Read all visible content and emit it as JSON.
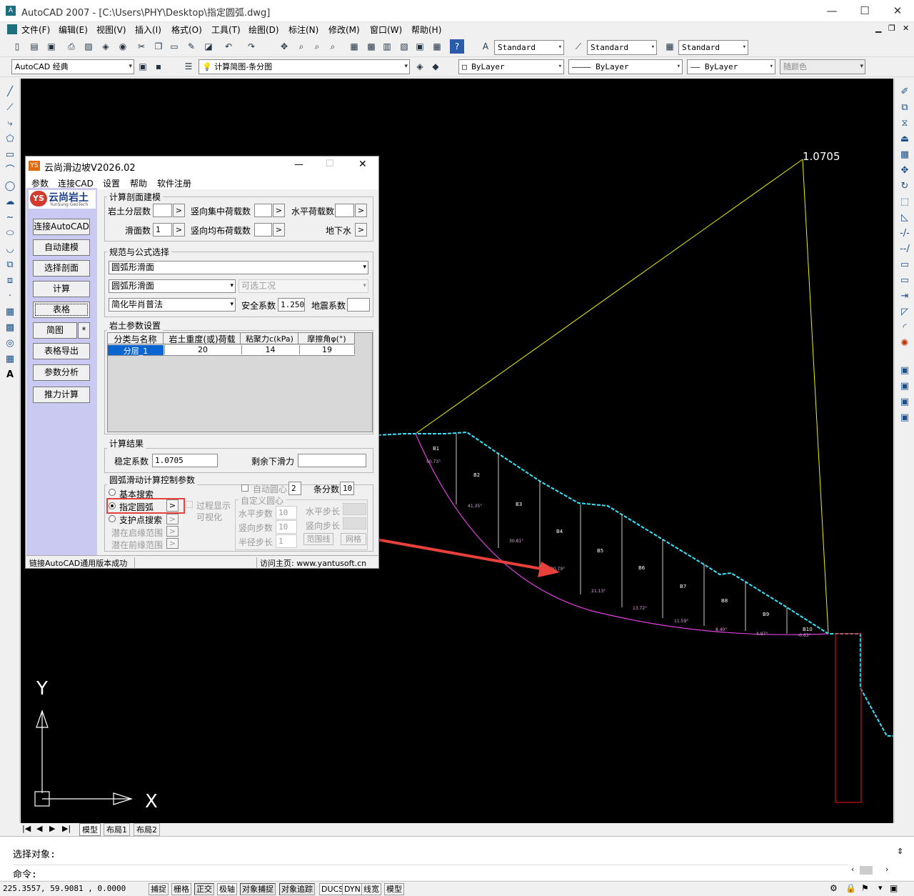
{
  "window": {
    "title": "AutoCAD 2007 - [C:\\Users\\PHY\\Desktop\\指定圆弧.dwg]",
    "min": "—",
    "max": "☐",
    "close": "✕"
  },
  "menu": [
    "文件(F)",
    "编辑(E)",
    "视图(V)",
    "插入(I)",
    "格式(O)",
    "工具(T)",
    "绘图(D)",
    "标注(N)",
    "修改(M)",
    "窗口(W)",
    "帮助(H)"
  ],
  "styles": {
    "text_style": "Standard",
    "dim_style": "Standard",
    "table_style": "Standard"
  },
  "workspace": "AutoCAD 经典",
  "layer": "计算简图-条分图",
  "props": {
    "color": "ByLayer",
    "linetype": "ByLayer",
    "lineweight": "ByLayer",
    "plotstyle": "随颜色"
  },
  "drawing": {
    "result_label": "1.0705",
    "slices": [
      "B1",
      "B2",
      "B3",
      "B4",
      "B5",
      "B6",
      "B7",
      "B8",
      "B9",
      "B10"
    ],
    "slice_angles": [
      "50.73°",
      "41.35°",
      "30.81°",
      "30.79°",
      "21.13°",
      "13.72°",
      "11.59°",
      "8.40°",
      "4.97°",
      "-0.63°"
    ],
    "ucs_x": "X",
    "ucs_y": "Y",
    "colors": {
      "slope": "#33e6ff",
      "arc": "#e040e0",
      "radius": "#f0f000",
      "pile": "#d01010",
      "arrow": "#e8403a"
    }
  },
  "layout_tabs": [
    "模型",
    "布局1",
    "布局2"
  ],
  "command": {
    "line1": "选择对象:",
    "line2": "命令:"
  },
  "status": {
    "coords": "225.3557, 59.9081 , 0.0000",
    "buttons": [
      "捕捉",
      "栅格",
      "正交",
      "极轴",
      "对象捕捉",
      "对象追踪",
      "DUCS",
      "DYN",
      "线宽",
      "模型"
    ]
  },
  "dialog": {
    "title": "云尚滑边坡V2026.02",
    "menu": [
      "参数",
      "连接CAD",
      "设置",
      "帮助",
      "软件注册"
    ],
    "logo_text": "云尚岩土",
    "logo_sub": "YunSung GeoTech",
    "side_buttons": [
      "连接AutoCAD",
      "自动建模",
      "选择剖面",
      "计算",
      "表格",
      "简图",
      "表格导出",
      "参数分析",
      "推力计算"
    ],
    "star": "*",
    "model_group": {
      "label": "计算剖面建模",
      "layers_label": "岩土分层数",
      "layers_value": "",
      "vconc_label": "竖向集中荷载数",
      "vconc_value": "",
      "hload_label": "水平荷载数",
      "hload_value": "",
      "slip_label": "滑面数",
      "slip_value": "1",
      "vdist_label": "竖向均布荷载数",
      "vdist_value": "",
      "water_label": "地下水"
    },
    "spec_group": {
      "label": "规范与公式选择",
      "surface": "圆弧形滑面",
      "surface2": "圆弧形滑面",
      "condition": "可选工况",
      "method": "简化毕肖普法",
      "safety_label": "安全系数",
      "safety_value": "1.250",
      "quake_label": "地震系数",
      "quake_value": ""
    },
    "soil_group": {
      "label": "岩土参数设置",
      "headers": [
        "分类与名称",
        "岩土重度(或)荷载",
        "粘聚力c(kPa)",
        "摩擦角φ(°)"
      ],
      "rows": [
        [
          "分层_1",
          "20",
          "14",
          "19"
        ]
      ]
    },
    "result_group": {
      "label": "计算结果",
      "fs_label": "稳定系数",
      "fs_value": "1.0705",
      "residual_label": "剩余下滑力",
      "residual_value": ""
    },
    "arc_group": {
      "label": "圆弧滑动计算控制参数",
      "opt_basic": "基本搜索",
      "opt_fixed": "指定圆弧",
      "opt_pile": "支护点搜索",
      "latent_start": "潜在启缘范围",
      "latent_front": "潜在前缘范围",
      "process_show": "过程显示",
      "visual": "可视化",
      "auto_center": "自动圆心",
      "auto_center_value": "2",
      "slices_label": "条分数",
      "slices_value": "10",
      "custom_center": "自定义圆心",
      "h_step": "水平步数",
      "h_step_value": "10",
      "v_step": "竖向步数",
      "v_step_value": "10",
      "r_step": "半径步长",
      "r_step_value": "1",
      "h_len": "水平步长",
      "v_len": "竖向步长",
      "range_btn": "范围线",
      "grid_btn": "网格"
    },
    "status_left": "链接AutoCAD通用版本成功",
    "status_right": "访问主页: www.yantusoft.cn"
  }
}
